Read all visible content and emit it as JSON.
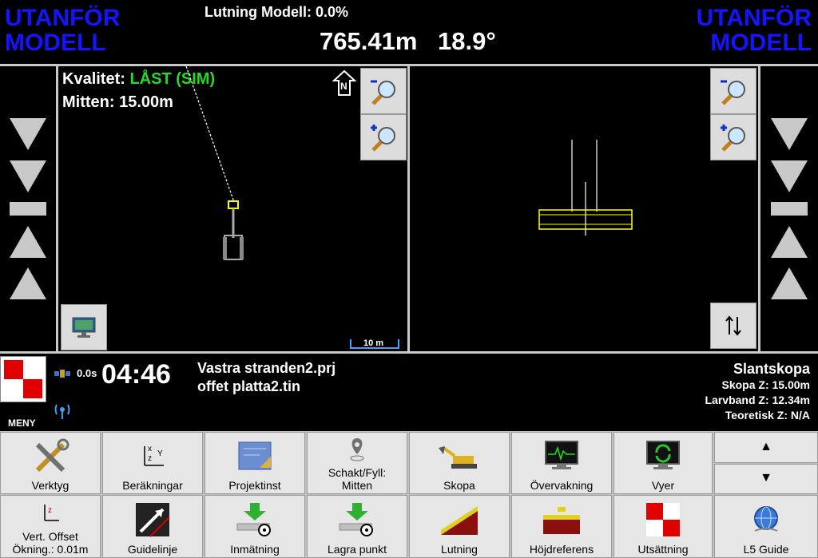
{
  "top": {
    "left_warning": [
      "UTANFÖR",
      "MODELL"
    ],
    "right_warning": [
      "UTANFÖR",
      "MODELL"
    ],
    "slope_label": "Lutning Modell: 0.0%",
    "distance": "765.41m",
    "angle": "18.9°"
  },
  "plan_view": {
    "quality_label": "Kvalitet:",
    "quality_value": "LÅST (SIM)",
    "center_label": "Mitten: 15.00m",
    "north_label": "N",
    "scale_label": "10 m"
  },
  "info": {
    "menu_label": "MENY",
    "gps_delay": "0.0s",
    "time": "04:46",
    "project_file": "Vastra stranden2.prj",
    "surface_file": "offet platta2.tin",
    "bucket_name": "Slantskopa",
    "bucket_z": "Skopa Z: 15.00m",
    "track_z": "Larvband Z: 12.34m",
    "theoretical_z": "Teoretisk Z: N/A"
  },
  "toolbar_row1": [
    {
      "label": "Verktyg",
      "icon": "tools-icon"
    },
    {
      "label": "Beräkningar",
      "icon": "xyz-axes-icon"
    },
    {
      "label": "Projektinst",
      "icon": "blueprint-icon"
    },
    {
      "label": "Schakt/Fyll:\nMitten",
      "icon": "location-pin-icon"
    },
    {
      "label": "Skopa",
      "icon": "excavator-icon"
    },
    {
      "label": "Övervakning",
      "icon": "monitor-icon"
    },
    {
      "label": "Vyer",
      "icon": "refresh-views-icon"
    }
  ],
  "toolbar_row2": [
    {
      "label": "Vert. Offset\nÖkning.: 0.01m",
      "icon": "vertical-offset-icon"
    },
    {
      "label": "Guidelinje",
      "icon": "guideline-icon"
    },
    {
      "label": "Inmätning",
      "icon": "survey-icon"
    },
    {
      "label": "Lagra punkt",
      "icon": "store-point-icon"
    },
    {
      "label": "Lutning",
      "icon": "slope-icon"
    },
    {
      "label": "Höjdreferens",
      "icon": "height-reference-icon"
    },
    {
      "label": "Utsättning",
      "icon": "stakeout-icon"
    },
    {
      "label": "L5 Guide",
      "icon": "globe-guide-icon"
    }
  ],
  "scroll": {
    "up": "▲",
    "down": "▼"
  },
  "colors": {
    "warning": "#1414ff",
    "quality_ok": "#22dd22",
    "panel_gray": "#c8c8c8",
    "button_bg": "#e6e6e6"
  }
}
